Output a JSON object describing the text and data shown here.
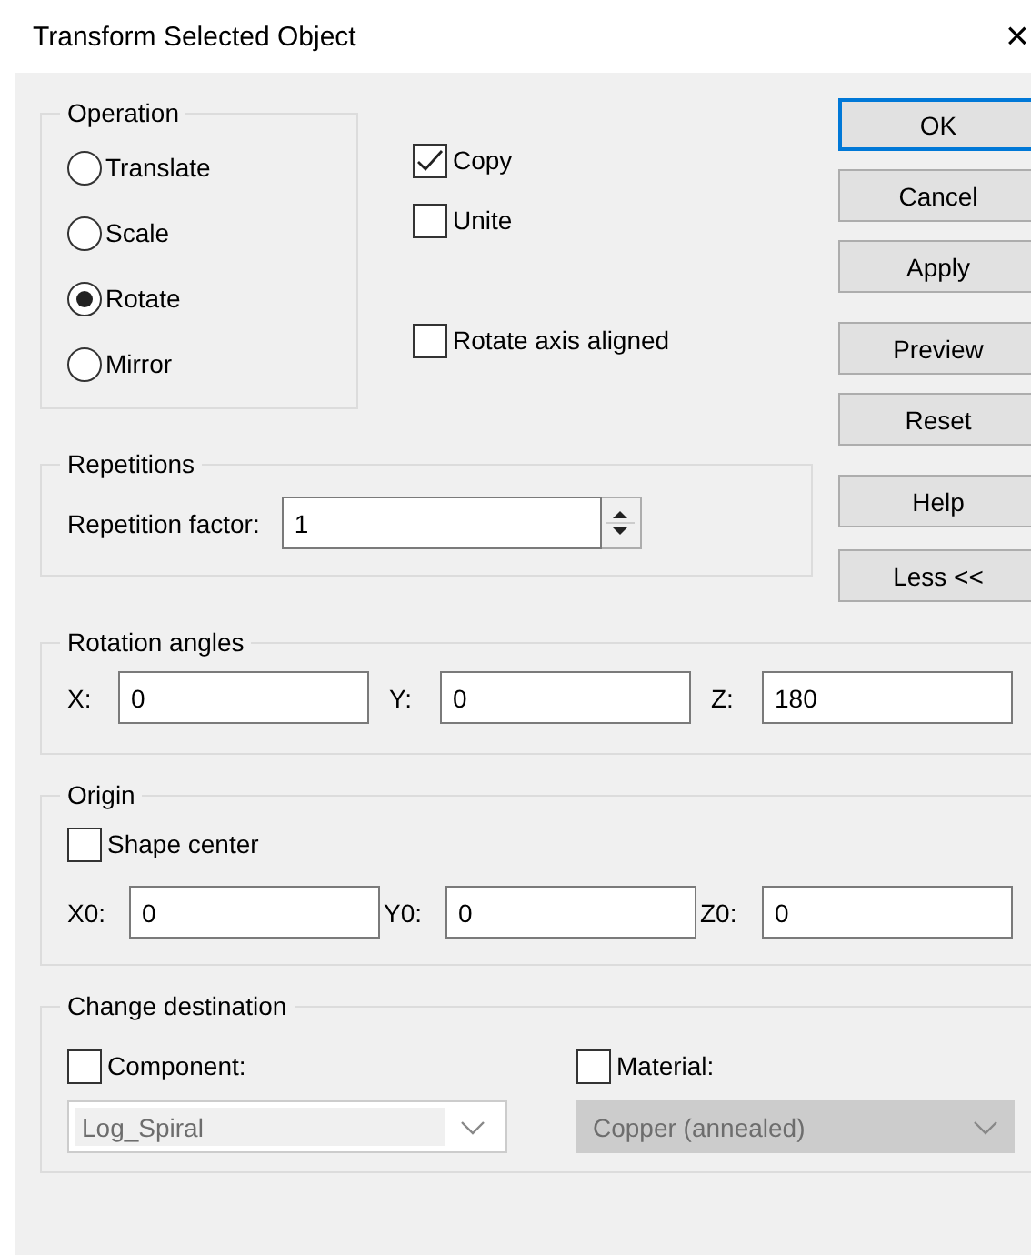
{
  "window": {
    "title": "Transform Selected Object",
    "close": "×"
  },
  "operation": {
    "title": "Operation",
    "options": [
      {
        "label": "Translate",
        "selected": false
      },
      {
        "label": "Scale",
        "selected": false
      },
      {
        "label": "Rotate",
        "selected": true
      },
      {
        "label": "Mirror",
        "selected": false
      }
    ]
  },
  "options": [
    {
      "label": "Copy",
      "checked": true
    },
    {
      "label": "Unite",
      "checked": false
    },
    {
      "label": "Rotate axis aligned",
      "checked": false
    }
  ],
  "buttons": [
    {
      "label": "OK",
      "default": true
    },
    {
      "label": "Cancel",
      "default": false
    },
    {
      "label": "Apply",
      "default": false
    },
    {
      "label": "Preview",
      "default": false
    },
    {
      "label": "Reset",
      "default": false
    },
    {
      "label": "Help",
      "default": false
    },
    {
      "label": "Less <<",
      "default": false
    }
  ],
  "repetitions": {
    "title": "Repetitions",
    "label": "Repetition factor:",
    "value": "1"
  },
  "rotation_angles": {
    "title": "Rotation angles",
    "fields": [
      {
        "label": "X:",
        "value": "0"
      },
      {
        "label": "Y:",
        "value": "0"
      },
      {
        "label": "Z:",
        "value": "180"
      }
    ]
  },
  "origin": {
    "title": "Origin",
    "shape_center": {
      "label": "Shape center",
      "checked": false
    },
    "fields": [
      {
        "label": "X0:",
        "value": "0"
      },
      {
        "label": "Y0:",
        "value": "0"
      },
      {
        "label": "Z0:",
        "value": "0"
      }
    ]
  },
  "change_destination": {
    "title": "Change destination",
    "targets": [
      {
        "label": "Component:",
        "checked": false,
        "value": "Log_Spiral",
        "disabled": true,
        "kind": "combo"
      },
      {
        "label": "Material:",
        "checked": false,
        "value": "Copper (annealed)",
        "disabled": true,
        "kind": "list"
      }
    ]
  }
}
